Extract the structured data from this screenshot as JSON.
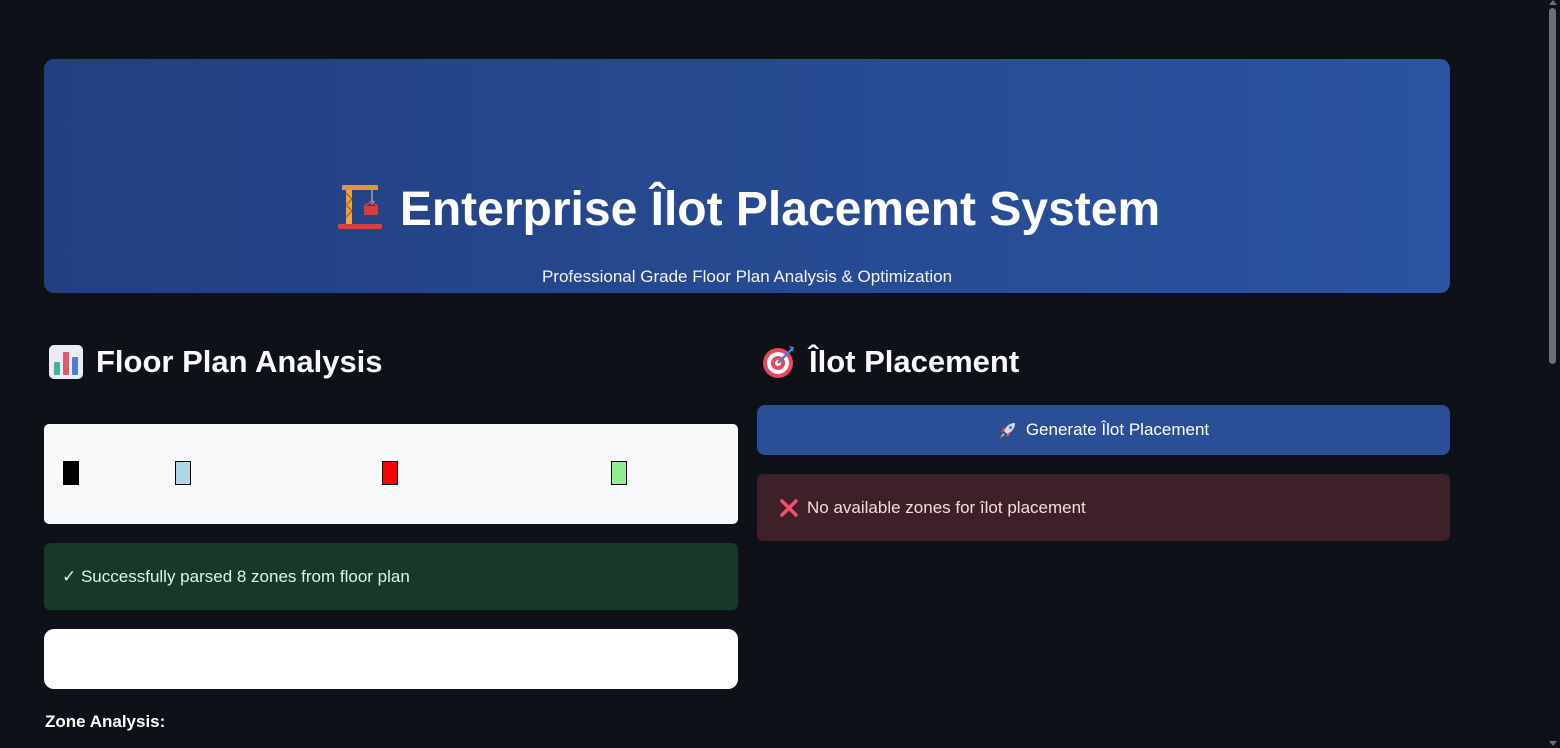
{
  "header": {
    "title": "Enterprise Îlot Placement System",
    "subtitle": "Professional Grade Floor Plan Analysis & Optimization",
    "icon": "construction-crane-icon"
  },
  "analysis": {
    "title": "Floor Plan Analysis",
    "icon": "bar-chart-icon",
    "legend_swatches": [
      {
        "name": "black-swatch",
        "color": "#000000"
      },
      {
        "name": "light-blue-swatch",
        "color": "#add8e6"
      },
      {
        "name": "red-swatch",
        "color": "#ff0000"
      },
      {
        "name": "light-green-swatch",
        "color": "#90ee90"
      }
    ],
    "success_message": "✓ Successfully parsed 8 zones from floor plan",
    "zone_label": "Zone Analysis:"
  },
  "placement": {
    "title": "Îlot Placement",
    "icon": "target-dart-icon",
    "generate_button_label": "Generate Îlot Placement",
    "button_icon": "rocket-icon",
    "error_message": "No available zones for îlot placement",
    "error_icon": "cross-mark-icon"
  },
  "colors": {
    "background": "#0e1117",
    "header_gradient_start": "#233f80",
    "header_gradient_end": "#2a54a0",
    "button": "#2a4f96",
    "success_bg": "#173928",
    "error_bg": "#3e2128"
  }
}
